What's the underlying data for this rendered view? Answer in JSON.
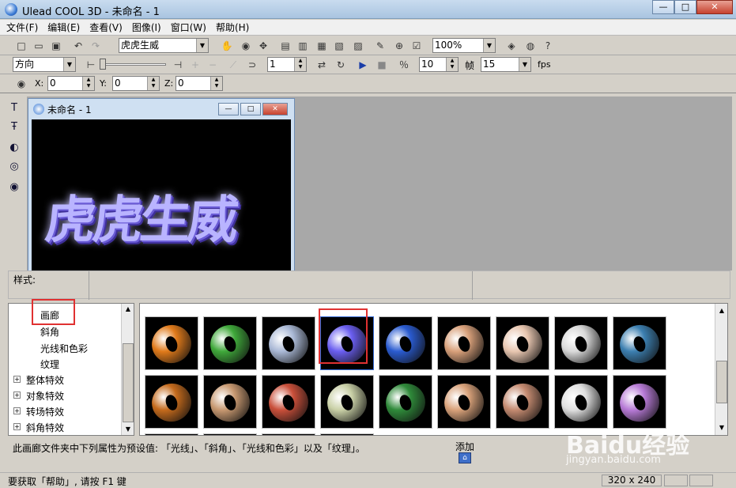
{
  "window": {
    "title": "Ulead COOL 3D - 未命名 - 1",
    "min": "—",
    "max": "□",
    "close": "✕"
  },
  "menu": [
    "文件(F)",
    "编辑(E)",
    "查看(V)",
    "图像(I)",
    "窗口(W)",
    "帮助(H)"
  ],
  "toolbar1": {
    "text_combo": "虎虎生威",
    "zoom_combo": "100%"
  },
  "toolbar2": {
    "mode_combo": "方向",
    "frame_value": "1",
    "frames_label": "帧",
    "frames_value": "10",
    "fps_value": "15",
    "fps_label": "fps"
  },
  "toolbar3": {
    "x_label": "X:",
    "x_value": "0",
    "y_label": "Y:",
    "y_value": "0",
    "z_label": "Z:",
    "z_value": "0"
  },
  "document": {
    "title": "未命名 - 1",
    "min": "—",
    "max": "□",
    "close": "✕",
    "canvas_text": "虎虎生威"
  },
  "style_panel": {
    "label": "样式:"
  },
  "tree": {
    "items": [
      {
        "label": "画廊",
        "expander": ""
      },
      {
        "label": "斜角",
        "expander": ""
      },
      {
        "label": "光线和色彩",
        "expander": ""
      },
      {
        "label": "纹理",
        "expander": ""
      },
      {
        "label": "整体特效",
        "expander": "+"
      },
      {
        "label": "对象特效",
        "expander": "+"
      },
      {
        "label": "转场特效",
        "expander": "+"
      },
      {
        "label": "斜角特效",
        "expander": "+"
      }
    ]
  },
  "gallery": {
    "colors": [
      "#e07a1a",
      "#3fa83a",
      "#aab9d6",
      "#6a5ef0",
      "#2a5bd0",
      "#d8a07a",
      "#e8c6b0",
      "#d9d9d9",
      "#3c7fb0",
      "#c46a1c",
      "#c79870",
      "#c94f3a",
      "#c9d0a6",
      "#2f8a3a",
      "#d9a27a",
      "#c48a70",
      "#e0e0e0",
      "#b77ad6"
    ],
    "selected_index": 3
  },
  "info": {
    "description": "此画廊文件夹中下列属性为预设值: 「光线」、「斜角」、「光线和色彩」以及「纹理」。",
    "add_label": "添加"
  },
  "status": {
    "message": "要获取「帮助」, 请按 F1 键",
    "dimensions": "320 x 240"
  },
  "watermark": {
    "brand": "Baidu经验",
    "url": "jingyan.baidu.com"
  },
  "icons": {
    "add": "house-icon"
  }
}
